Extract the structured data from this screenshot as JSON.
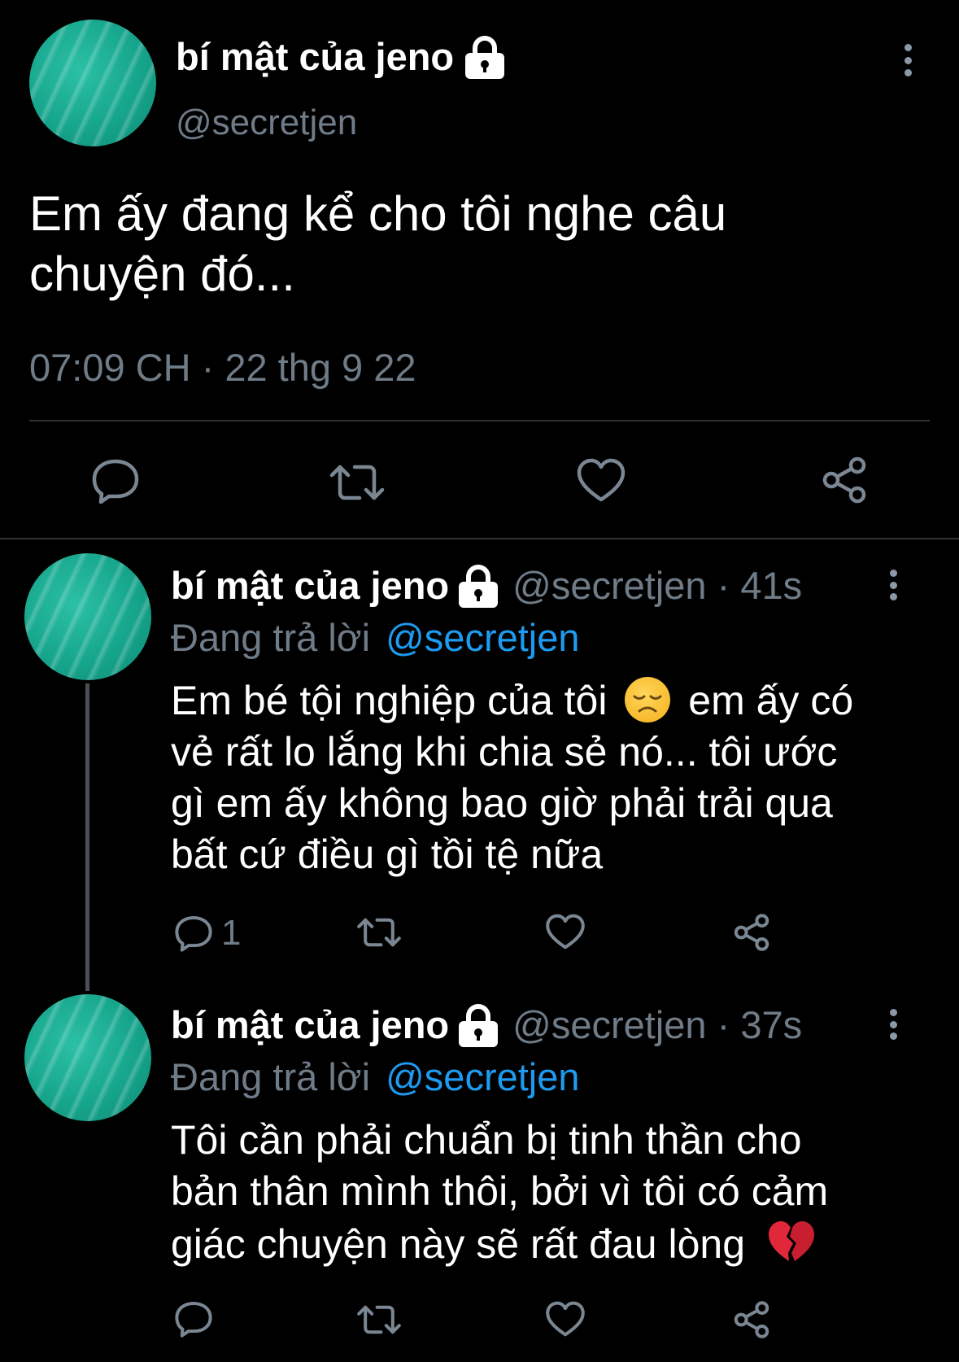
{
  "main_tweet": {
    "display_name": "bí mật của jeno",
    "handle": "@secretjen",
    "text_line1": "Em ấy đang kể cho tôi nghe câu",
    "text_line2": "chuyện đó...",
    "timestamp": "07:09 CH · 22 thg 9 22",
    "protected_icon": "lock-icon",
    "actions": [
      "reply-icon",
      "retweet-icon",
      "like-icon",
      "share-icon"
    ]
  },
  "replies": [
    {
      "display_name": "bí mật của jeno",
      "handle_time": "@secretjen · 41s",
      "replying_prefix": "Đang trả lời",
      "replying_to": "@secretjen",
      "lines": [
        "Em bé tội nghiệp của tôi",
        "em ấy có",
        "vẻ rất lo lắng khi chia sẻ nó... tôi ước",
        "gì em ấy không bao giờ phải trải qua",
        "bất cứ điều gì tồi tệ nữa"
      ],
      "emoji": "disappointed-face-emoji",
      "reply_count": "1"
    },
    {
      "display_name": "bí mật của jeno",
      "handle_time": "@secretjen · 37s",
      "replying_prefix": "Đang trả lời",
      "replying_to": "@secretjen",
      "lines": [
        "Tôi cần phải chuẩn bị tinh thần cho",
        "bản thân mình thôi, bởi vì tôi có cảm",
        "giác chuyện này sẽ rất đau lòng"
      ],
      "emoji": "broken-heart-emoji",
      "reply_count": ""
    }
  ],
  "colors": {
    "background": "#000000",
    "muted": "#6f7c88",
    "link": "#1d9bf0",
    "avatar": "#16a58c",
    "divider": "#2f3336"
  }
}
